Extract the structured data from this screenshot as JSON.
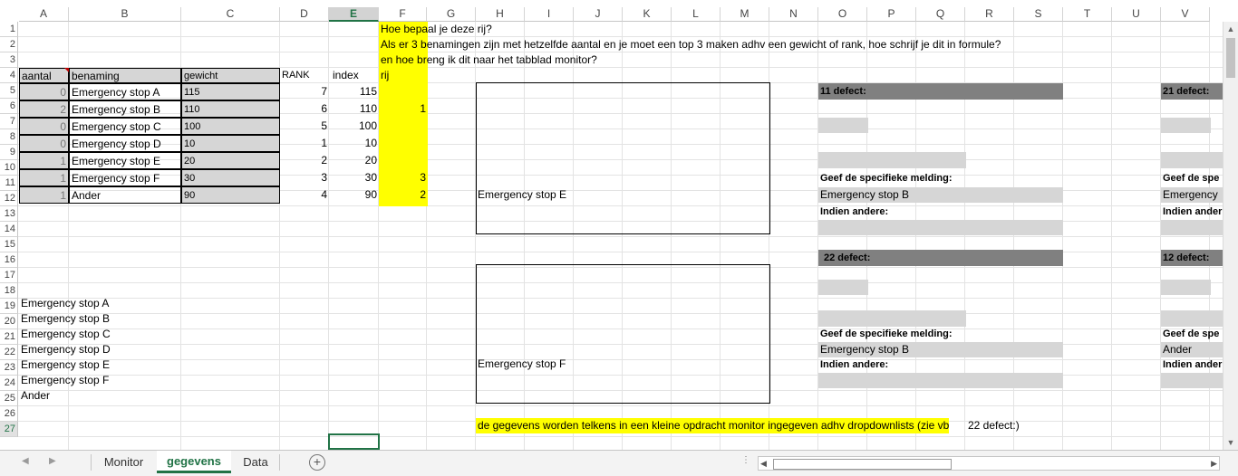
{
  "columns": [
    {
      "label": "A",
      "width": 55
    },
    {
      "label": "B",
      "width": 124
    },
    {
      "label": "C",
      "width": 109
    },
    {
      "label": "D",
      "width": 54
    },
    {
      "label": "E",
      "width": 55
    },
    {
      "label": "F",
      "width": 53
    },
    {
      "label": "G",
      "width": 54
    },
    {
      "label": "H",
      "width": 54
    },
    {
      "label": "I",
      "width": 54
    },
    {
      "label": "J",
      "width": 54
    },
    {
      "label": "K",
      "width": 54
    },
    {
      "label": "L",
      "width": 54
    },
    {
      "label": "M",
      "width": 54
    },
    {
      "label": "N",
      "width": 54
    },
    {
      "label": "O",
      "width": 54
    },
    {
      "label": "P",
      "width": 54
    },
    {
      "label": "Q",
      "width": 54
    },
    {
      "label": "R",
      "width": 54
    },
    {
      "label": "S",
      "width": 54
    },
    {
      "label": "T",
      "width": 54
    },
    {
      "label": "U",
      "width": 54
    },
    {
      "label": "V",
      "width": 54
    }
  ],
  "rows": [
    "1",
    "2",
    "3",
    "4",
    "5",
    "6",
    "7",
    "8",
    "9",
    "10",
    "11",
    "12",
    "13",
    "14",
    "15",
    "16",
    "17",
    "18",
    "19",
    "20",
    "21",
    "22",
    "23",
    "24",
    "25",
    "26",
    "27"
  ],
  "selected": {
    "column": "E",
    "row": "27"
  },
  "notes": {
    "q1": "Hoe bepaal je deze rij?",
    "q2": "Als er 3 benamingen zijn met hetzelfde aantal en je moet een top 3 maken adhv een gewicht of rank, hoe schrijf je dit in formule?",
    "q3": "en hoe breng ik dit naar het tabblad monitor?",
    "q4": "rij",
    "footer_yellow": "de gegevens worden telkens in een kleine opdracht monitor ingegeven adhv dropdownlists (zie vb",
    "footer_plain": "22 defect:)"
  },
  "table": {
    "headers": {
      "aantal": "aantal",
      "benaming": "benaming",
      "gewicht": "gewicht",
      "rank": "RANK",
      "index": "index"
    },
    "rows": [
      {
        "aantal": "0",
        "benaming": "Emergency stop A",
        "gewicht": "115",
        "rank": "7",
        "index": "115",
        "rij": ""
      },
      {
        "aantal": "2",
        "benaming": "Emergency stop B",
        "gewicht": "110",
        "rank": "6",
        "index": "110",
        "rij": "1"
      },
      {
        "aantal": "0",
        "benaming": "Emergency stop C",
        "gewicht": "100",
        "rank": "5",
        "index": "100",
        "rij": ""
      },
      {
        "aantal": "0",
        "benaming": "Emergency stop D",
        "gewicht": "10",
        "rank": "1",
        "index": "10",
        "rij": ""
      },
      {
        "aantal": "1",
        "benaming": "Emergency stop E",
        "gewicht": "20",
        "rank": "2",
        "index": "20",
        "rij": ""
      },
      {
        "aantal": "1",
        "benaming": "Emergency stop F",
        "gewicht": "30",
        "rank": "3",
        "index": "30",
        "rij": "3"
      },
      {
        "aantal": "1",
        "benaming": "Ander",
        "gewicht": "90",
        "rank": "4",
        "index": "90",
        "rij": "2"
      }
    ]
  },
  "list": [
    "Emergency stop A",
    "Emergency stop B",
    "Emergency stop C",
    "Emergency stop D",
    "Emergency stop E",
    "Emergency stop F",
    "Ander"
  ],
  "boxes": {
    "top_text": "Emergency stop E",
    "bottom_text": "Emergency stop F"
  },
  "panels": {
    "p11": {
      "title": "11 defect:",
      "melding_label": "Geef de specifieke melding:",
      "melding_value": "Emergency stop B",
      "andere_label": "Indien andere:"
    },
    "p21": {
      "title": "21 defect:",
      "melding_label": "Geef de spe",
      "melding_value": "Emergency",
      "andere_label": "Indien ander"
    },
    "p22": {
      "title": "22 defect:",
      "melding_label": "Geef de specifieke melding:",
      "melding_value": "Emergency stop B",
      "andere_label": "Indien andere:"
    },
    "p12": {
      "title": "12 defect:",
      "melding_label": "Geef de spe",
      "melding_value": "Ander",
      "andere_label": "Indien ander"
    }
  },
  "tabs": [
    {
      "label": "Monitor",
      "active": false
    },
    {
      "label": "gegevens",
      "active": true
    },
    {
      "label": "Data",
      "active": false
    }
  ],
  "colors": {
    "accent": "#217346",
    "yellow": "#ffff00",
    "header_gray": "#808080",
    "input_gray": "#d6d6d6"
  }
}
